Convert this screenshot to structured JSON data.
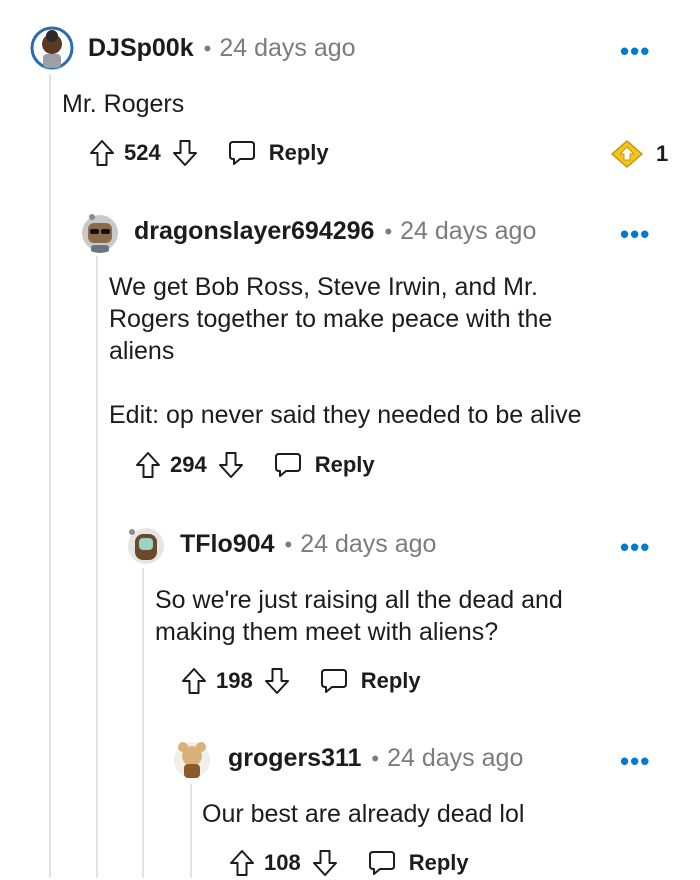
{
  "comments": [
    {
      "username": "DJSp00k",
      "separator": "•",
      "time": "24 days ago",
      "more": "•••",
      "body": [
        "Mr. Rogers"
      ],
      "upvotes": "524",
      "reply": "Reply",
      "award_count": "1"
    },
    {
      "username": "dragonslayer694296",
      "separator": "•",
      "time": "24 days ago",
      "more": "•••",
      "body": [
        "We get Bob Ross, Steve Irwin, and Mr.",
        "Rogers together to make peace with the",
        "aliens",
        "",
        "Edit: op never said they needed to be alive"
      ],
      "upvotes": "294",
      "reply": "Reply"
    },
    {
      "username": "TFlo904",
      "separator": "•",
      "time": "24 days ago",
      "more": "•••",
      "body": [
        "So we're just raising all the dead and",
        "making them meet with aliens?"
      ],
      "upvotes": "198",
      "reply": "Reply"
    },
    {
      "username": "grogers311",
      "separator": "•",
      "time": "24 days ago",
      "more": "•••",
      "body": [
        "Our best are already dead lol"
      ],
      "upvotes": "108",
      "reply": "Reply"
    }
  ],
  "icons": {
    "upvote": "upvote-arrow-icon",
    "downvote": "downvote-arrow-icon",
    "reply": "speech-bubble-icon",
    "award": "award-icon"
  },
  "colors": {
    "accent": "#0079d3",
    "meta": "#7c7c7c",
    "thread_line": "#e3e3e3",
    "award_gold": "#f5c518"
  }
}
